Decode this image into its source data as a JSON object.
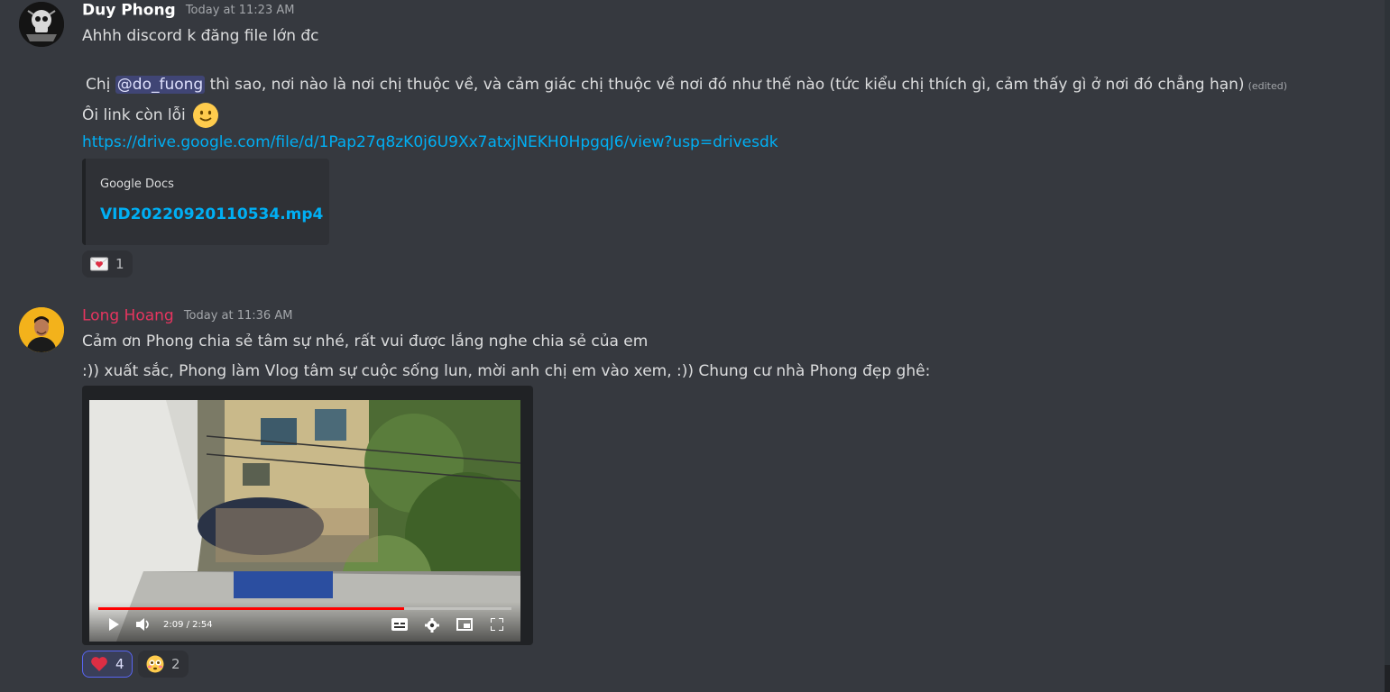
{
  "messages": [
    {
      "username": "Duy Phong",
      "username_color": "#ffffff",
      "timestamp": "Today at 11:23 AM",
      "lines": {
        "line1": "Ahhh discord k đăng file lớn đc",
        "line2_pre": "Chị ",
        "mention": "@do_fuong",
        "line2_post": " thì sao, nơi nào là nơi chị thuộc về, và cảm giác chị thuộc về nơi đó như thế nào (tức kiểu chị thích gì, cảm thấy gì ở nơi đó chẳng hạn)",
        "edited": "(edited)",
        "line3": "Ôi link còn lỗi",
        "link": "https://drive.google.com/file/d/1Pap27q8zK0j6U9Xx7atxjNEKH0HpgqJ6/view?usp=drivesdk"
      },
      "embed": {
        "provider": "Google Docs",
        "title": "VID20220920110534.mp4"
      },
      "reactions": [
        {
          "emoji": "love-letter-icon",
          "count": "1"
        }
      ]
    },
    {
      "username": "Long Hoang",
      "username_color": "#e6355f",
      "timestamp": "Today at 11:36 AM",
      "lines": {
        "line1": "Cảm ơn Phong chia sẻ tâm sự nhé, rất vui được lắng nghe chia sẻ của em",
        "line2": ":)) xuất sắc, Phong làm Vlog tâm sự cuộc sống lun, mời anh chị em vào xem, :)) Chung cư nhà Phong đẹp ghê:"
      },
      "video": {
        "time": "2:09 / 2:54",
        "progress": 0.74
      },
      "reactions": [
        {
          "emoji": "heart-icon",
          "count": "4",
          "selected": true
        },
        {
          "emoji": "flushed-face-icon",
          "count": "2",
          "selected": false
        }
      ]
    }
  ]
}
